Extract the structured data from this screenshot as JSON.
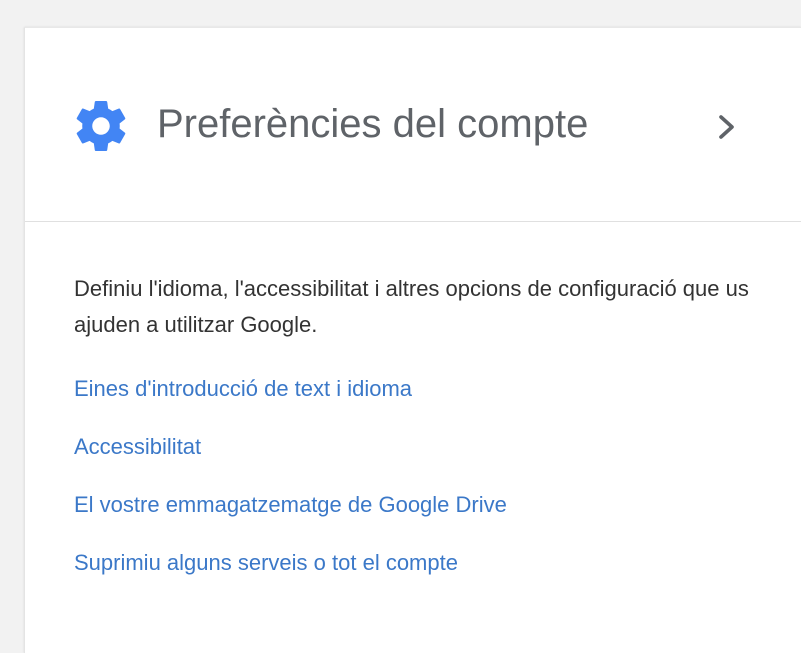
{
  "card": {
    "title": "Preferències del compte",
    "header_icon": "gear-icon",
    "chevron_icon": "chevron-right-icon",
    "description": "Definiu l'idioma, l'accessibilitat i altres opcions de configuració que us ajuden a utilitzar Google.",
    "links": [
      {
        "label": "Eines d'introducció de text i idioma"
      },
      {
        "label": "Accessibilitat"
      },
      {
        "label": "El vostre emmagatzematge de Google Drive"
      },
      {
        "label": "Suprimiu alguns serveis o tot el compte"
      }
    ]
  },
  "colors": {
    "accent": "#4285f4",
    "link": "#3b78c8",
    "title": "#5f6368",
    "body_text": "#333333"
  }
}
